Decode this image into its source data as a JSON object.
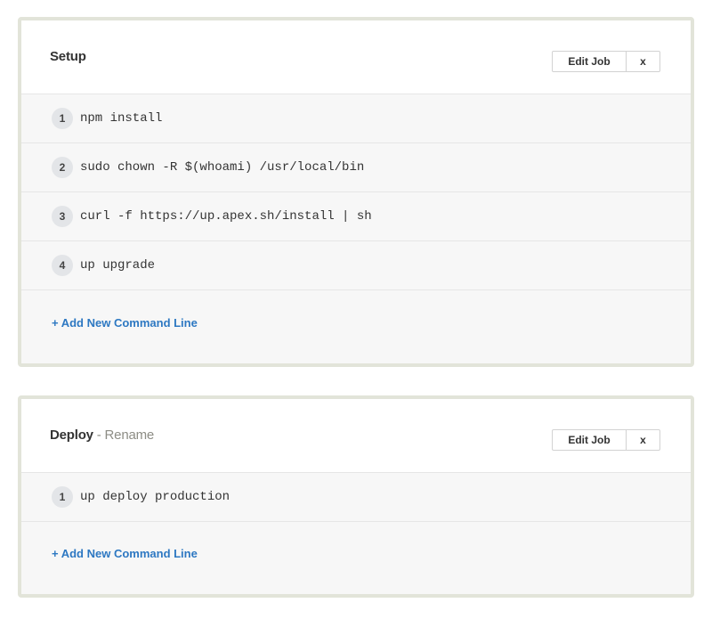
{
  "jobs": [
    {
      "title": "Setup",
      "rename_label": "",
      "edit_label": "Edit Job",
      "close_label": "x",
      "commands": [
        {
          "num": "1",
          "text": "npm install"
        },
        {
          "num": "2",
          "text": "sudo chown -R $(whoami) /usr/local/bin"
        },
        {
          "num": "3",
          "text": "curl -f https://up.apex.sh/install | sh"
        },
        {
          "num": "4",
          "text": "up upgrade"
        }
      ],
      "add_label": "+ Add New Command Line"
    },
    {
      "title": "Deploy",
      "rename_label": "- Rename",
      "edit_label": "Edit Job",
      "close_label": "x",
      "commands": [
        {
          "num": "1",
          "text": "up deploy production"
        }
      ],
      "add_label": "+ Add New Command Line"
    }
  ],
  "colors": {
    "panel_border": "#e2e4d9",
    "link": "#2d78c2",
    "rename": "#8d8d85"
  }
}
